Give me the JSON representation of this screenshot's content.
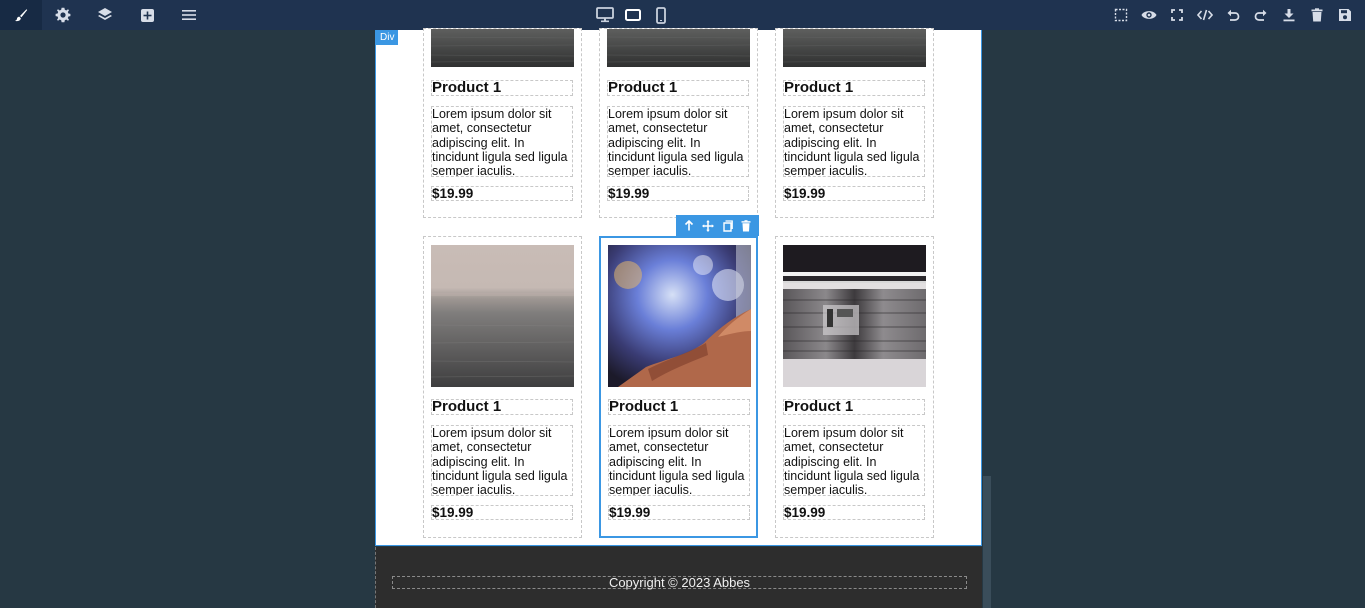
{
  "left_tools": [
    {
      "icon": "brush-icon",
      "active": true
    },
    {
      "icon": "gear-icon"
    },
    {
      "icon": "layers-icon"
    },
    {
      "icon": "add-block-icon"
    },
    {
      "icon": "menu-icon"
    }
  ],
  "devices": [
    {
      "icon": "desktop-icon"
    },
    {
      "icon": "tablet-icon",
      "active": true
    },
    {
      "icon": "mobile-icon"
    }
  ],
  "right_tools": [
    "select-outline-icon",
    "preview-eye-icon",
    "fullscreen-icon",
    "code-icon",
    "undo-icon",
    "redo-icon",
    "download-icon",
    "trash-icon",
    "save-icon"
  ],
  "selected_badge": "Div",
  "products": [
    {
      "title": "Product 1",
      "description": "Lorem ipsum dolor sit amet, consectetur adipiscing elit. In tincidunt ligula sed ligula semper iaculis.",
      "price": "$19.99",
      "image": "sea-dark"
    },
    {
      "title": "Product 1",
      "description": "Lorem ipsum dolor sit amet, consectetur adipiscing elit. In tincidunt ligula sed ligula semper iaculis.",
      "price": "$19.99",
      "image": "sea-dark"
    },
    {
      "title": "Product 1",
      "description": "Lorem ipsum dolor sit amet, consectetur adipiscing elit. In tincidunt ligula sed ligula semper iaculis.",
      "price": "$19.99",
      "image": "sea-dark"
    },
    {
      "title": "Product 1",
      "description": "Lorem ipsum dolor sit amet, consectetur adipiscing elit. In tincidunt ligula sed ligula semper iaculis.",
      "price": "$19.99",
      "image": "foggy-sea"
    },
    {
      "title": "Product 1",
      "description": "Lorem ipsum dolor sit amet, consectetur adipiscing elit. In tincidunt ligula sed ligula semper iaculis.",
      "price": "$19.99",
      "image": "hand-touchscreen"
    },
    {
      "title": "Product 1",
      "description": "Lorem ipsum dolor sit amet, consectetur adipiscing elit. In tincidunt ligula sed ligula semper iaculis.",
      "price": "$19.99",
      "image": "subway-motion"
    }
  ],
  "selection_toolbar": [
    "arrow-up-icon",
    "move-icon",
    "copy-icon",
    "delete-icon"
  ],
  "footer": {
    "text": "Copyright © 2023 Abbes"
  },
  "colors": {
    "accent": "#3b97e3",
    "topbar": "#1f3350",
    "background": "#263843",
    "footer": "#2d2d2d"
  }
}
